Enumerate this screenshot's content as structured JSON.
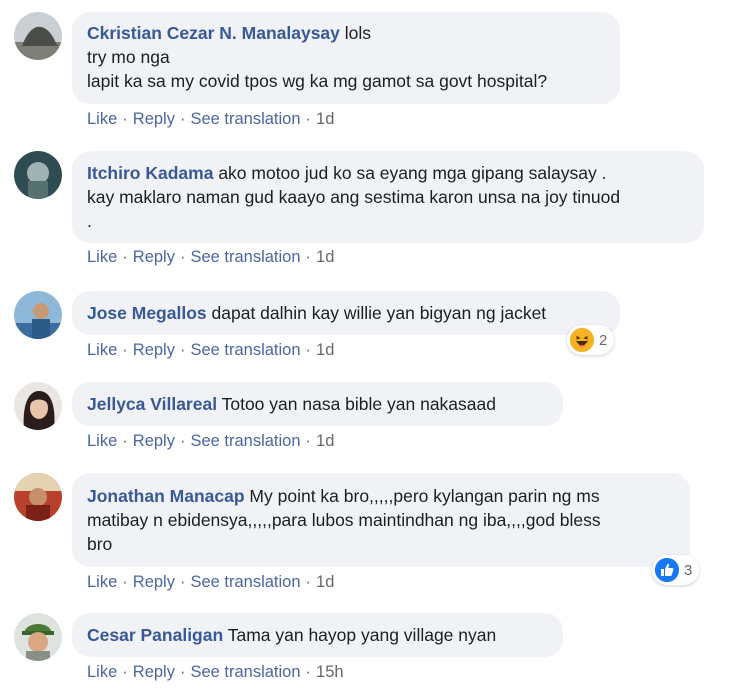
{
  "actions": {
    "like": "Like",
    "reply": "Reply",
    "see_translation": "See translation",
    "separator": "·"
  },
  "comments": [
    {
      "author": "Ckristian Cezar N. Manalaysay",
      "text_lines": [
        "lols",
        "try mo nga",
        "lapit ka sa my covid tpos wg ka mg gamot sa govt hospital?"
      ],
      "time": "1d"
    },
    {
      "author": "Itchiro Kadama",
      "text_lines": [
        "ako motoo jud ko sa eyang mga gipang salaysay .",
        "kay maklaro naman gud kaayo ang sestima karon unsa na joy tinuod",
        "."
      ],
      "time": "1d"
    },
    {
      "author": "Jose Megallos",
      "text_lines": [
        "dapat dalhin kay willie yan bigyan ng jacket"
      ],
      "time": "1d",
      "reaction": {
        "icon": "haha-icon",
        "count": "2",
        "color": "#f7b125"
      }
    },
    {
      "author": "Jellyca Villareal",
      "text_lines": [
        "Totoo yan nasa bible yan nakasaad"
      ],
      "time": "1d"
    },
    {
      "author": "Jonathan Manacap",
      "text_lines": [
        "My point ka bro,,,,,pero kylangan parin ng ms",
        "matibay n ebidensya,,,,,para lubos maintindhan ng iba,,,,god bless",
        "bro"
      ],
      "time": "1d",
      "reaction": {
        "icon": "like-icon",
        "count": "3",
        "color": "#1877f2"
      }
    },
    {
      "author": "Cesar Panaligan",
      "text_lines": [
        "Tama yan hayop yang village nyan"
      ],
      "time": "15h"
    }
  ]
}
